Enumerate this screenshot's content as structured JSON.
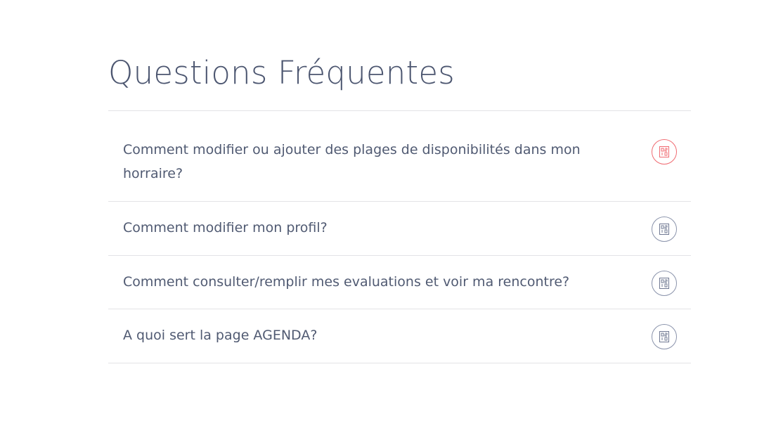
{
  "faq": {
    "title": "Questions Fréquentes",
    "accent_color": "#f06b72",
    "icon_color": "#8a93ab",
    "items": [
      {
        "question": "Comment modifier ou ajouter des plages de disponibilités dans mon horraire?",
        "active": true,
        "icon": "glyph-icon"
      },
      {
        "question": "Comment modifier mon profil?",
        "active": false,
        "icon": "glyph-icon"
      },
      {
        "question": "Comment consulter/remplir mes evaluations et voir ma rencontre?",
        "active": false,
        "icon": "glyph-icon"
      },
      {
        "question": "A quoi sert la page AGENDA?",
        "active": false,
        "icon": "glyph-icon"
      }
    ]
  }
}
